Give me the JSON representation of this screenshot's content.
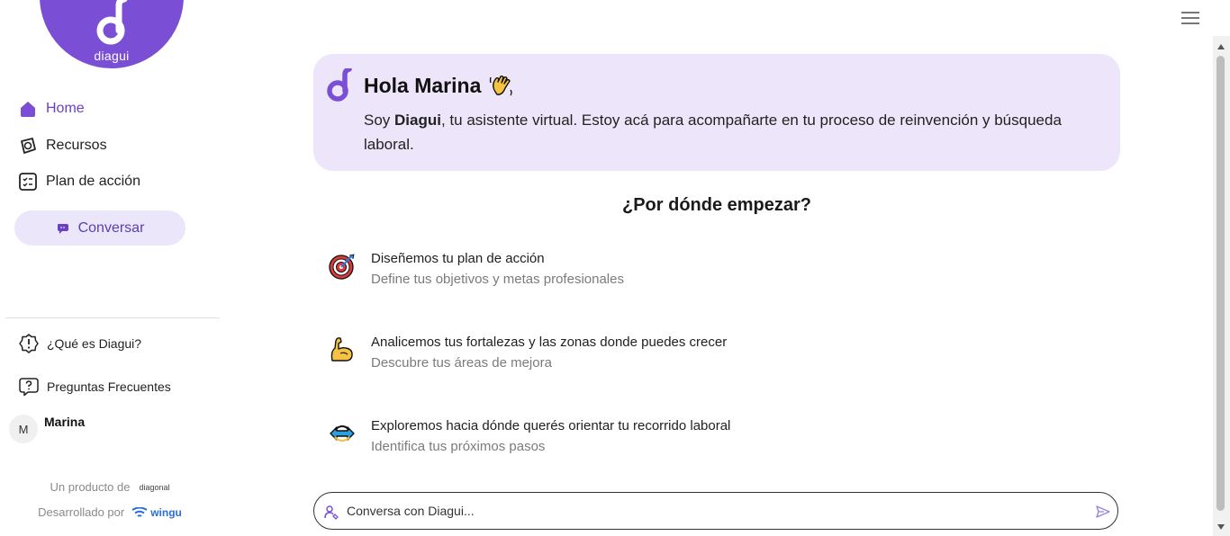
{
  "brand": {
    "name": "diagui"
  },
  "sidebar": {
    "items": [
      {
        "label": "Home",
        "icon": "home-icon",
        "active": true
      },
      {
        "label": "Recursos",
        "icon": "resources-icon",
        "active": false
      },
      {
        "label": "Plan de acción",
        "icon": "checklist-icon",
        "active": false
      }
    ],
    "cta_label": "Conversar",
    "help": [
      {
        "label": "¿Qué es Diagui?",
        "icon": "info-badge-icon"
      },
      {
        "label": "Preguntas Frecuentes",
        "icon": "question-bubble-icon"
      }
    ],
    "user": {
      "initial": "M",
      "name": "Marina"
    },
    "credits": {
      "product_prefix": "Un producto de",
      "product_brand": "diagonal",
      "dev_prefix": "Desarrollado por",
      "dev_brand": "wingu"
    }
  },
  "greeting": {
    "title": "Hola Marina",
    "pre": "Soy ",
    "name": "Diagui",
    "post": ", tu asistente virtual. Estoy acá para acompañarte en tu proceso de reinvención y búsqueda laboral."
  },
  "start": {
    "title": "¿Por dónde empezar?",
    "options": [
      {
        "title": "Diseñemos tu plan de acción",
        "subtitle": "Define tus objetivos y metas profesionales",
        "icon": "target-icon"
      },
      {
        "title": "Analicemos tus fortalezas y las zonas donde puedes crecer",
        "subtitle": "Descubre tus áreas de mejora",
        "icon": "flexed-arm-icon"
      },
      {
        "title": "Exploremos hacia dónde querés orientar tu recorrido laboral",
        "subtitle": "Identifica tus próximos pasos",
        "icon": "direction-arrows-icon"
      }
    ]
  },
  "chat": {
    "placeholder": "Conversa con Diagui..."
  },
  "colors": {
    "accent": "#7a4fd6",
    "accent_light": "#ede6fb",
    "button_bg": "#ece6fb"
  }
}
